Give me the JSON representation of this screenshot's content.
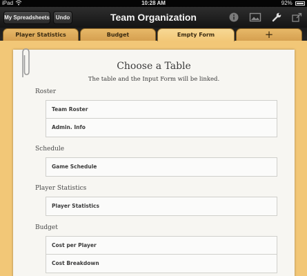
{
  "status_bar": {
    "carrier": "iPad",
    "time": "10:28 AM",
    "battery": "92%"
  },
  "toolbar": {
    "spreadsheets_label": "My Spreadsheets",
    "undo_label": "Undo",
    "title": "Team Organization",
    "icons": [
      "info-icon",
      "image-icon",
      "wrench-icon",
      "share-icon"
    ]
  },
  "tabs": [
    {
      "label": "Player Statistics",
      "active": false
    },
    {
      "label": "Budget",
      "active": false
    },
    {
      "label": "Empty Form",
      "active": true
    },
    {
      "label": "+",
      "active": false
    }
  ],
  "dialog": {
    "title": "Choose a Table",
    "subtitle": "The table and the Input Form will be linked.",
    "sections": [
      {
        "label": "Roster",
        "tables": [
          "Team Roster",
          "Admin. Info"
        ]
      },
      {
        "label": "Schedule",
        "tables": [
          "Game Schedule"
        ]
      },
      {
        "label": "Player Statistics",
        "tables": [
          "Player Statistics"
        ]
      },
      {
        "label": "Budget",
        "tables": [
          "Cost per Player",
          "Cost Breakdown"
        ]
      }
    ]
  },
  "colors": {
    "background": "#f2c777",
    "toolbar": "#1e1e1e",
    "sheet": "#f7f6f2"
  }
}
